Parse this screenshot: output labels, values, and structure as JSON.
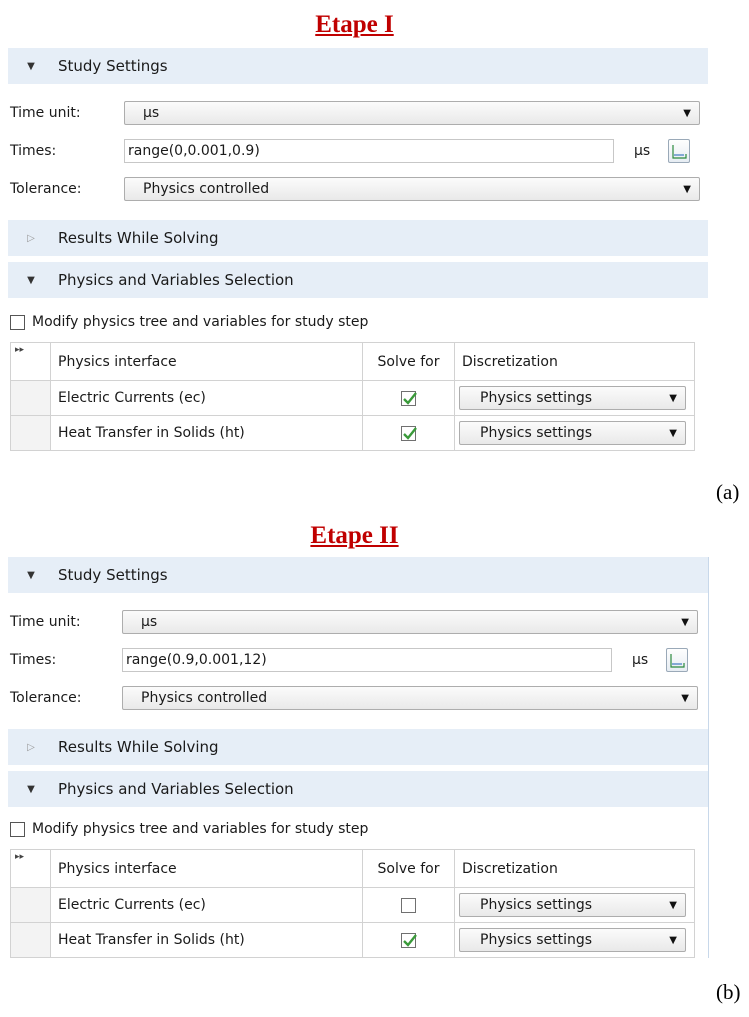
{
  "figure": {
    "step1_heading": "Etape I",
    "step2_heading": "Etape II",
    "label_a": "(a)",
    "label_b": "(b)"
  },
  "panels": [
    {
      "study_settings_title": "Study Settings",
      "time_unit_label": "Time unit:",
      "time_unit_value": "µs",
      "times_label": "Times:",
      "times_value": "range(0,0.001,0.9)",
      "times_unit": "µs",
      "tolerance_label": "Tolerance:",
      "tolerance_value": "Physics controlled",
      "results_title": "Results While Solving",
      "physics_title": "Physics and Variables Selection",
      "modify_label": "Modify physics tree and variables for study step",
      "modify_checked": false,
      "table": {
        "columns": [
          "Physics interface",
          "Solve for",
          "Discretization"
        ],
        "rows": [
          {
            "interface": "Electric Currents (ec)",
            "solve_for": true,
            "discretization": "Physics settings"
          },
          {
            "interface": "Heat Transfer in Solids (ht)",
            "solve_for": true,
            "discretization": "Physics settings"
          }
        ]
      }
    },
    {
      "study_settings_title": "Study Settings",
      "time_unit_label": "Time unit:",
      "time_unit_value": "µs",
      "times_label": "Times:",
      "times_value": "range(0.9,0.001,12)",
      "times_unit": "µs",
      "tolerance_label": "Tolerance:",
      "tolerance_value": "Physics controlled",
      "results_title": "Results While Solving",
      "physics_title": "Physics and Variables Selection",
      "modify_label": "Modify physics tree and variables for study step",
      "modify_checked": false,
      "table": {
        "columns": [
          "Physics interface",
          "Solve for",
          "Discretization"
        ],
        "rows": [
          {
            "interface": "Electric Currents (ec)",
            "solve_for": false,
            "discretization": "Physics settings"
          },
          {
            "interface": "Heat Transfer in Solids (ht)",
            "solve_for": true,
            "discretization": "Physics settings"
          }
        ]
      }
    }
  ],
  "colors": {
    "heading_red": "#c00000",
    "section_header_bg": "#e6eef7",
    "check_green": "#3a9a3a"
  }
}
